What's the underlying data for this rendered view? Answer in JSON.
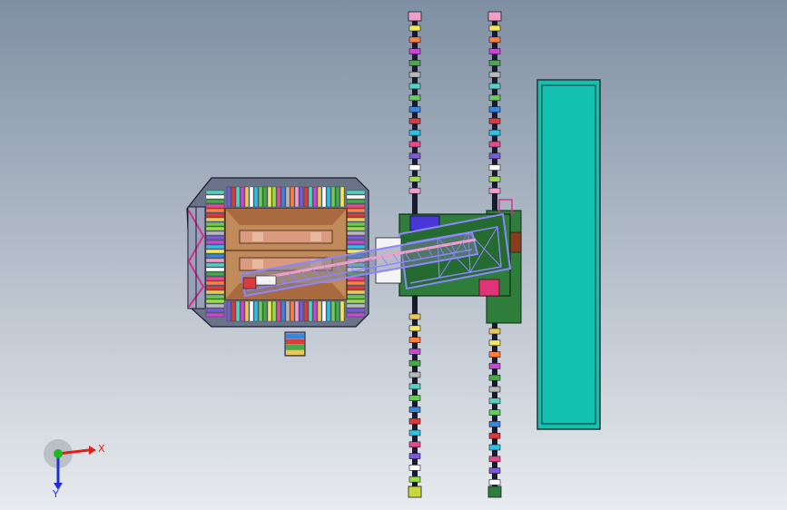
{
  "viewport": {
    "background_top": "#7f8fa3",
    "background_bottom": "#e8ebef"
  },
  "triad": {
    "x_label": "X",
    "y_label": "Y",
    "x_color": "#e0201c",
    "y_color": "#1fb81f",
    "z_color": "#1c2fe0"
  },
  "palette": {
    "plate_tan": "#c08a5a",
    "plate_salmon": "#d99a7e",
    "module_green": "#2e7d3a",
    "tank_teal": "#14c0b0",
    "boom_violet": "#8e86ff",
    "rail_dark": "#1a1a2e",
    "accent_pink": "#e0337a",
    "accent_blue": "#4a35d8",
    "accent_brown": "#8a3c1c"
  },
  "stripe_colors": [
    "#e84a8a",
    "#57d2c0",
    "#f2e95a",
    "#7b5cd6",
    "#6acb5a",
    "#ff7f3f",
    "#ffffff",
    "#3b86d8",
    "#c64ad2",
    "#9bde4a",
    "#dc3b3b",
    "#48a84a",
    "#f0a0c8",
    "#30c0e0",
    "#b8b8b8",
    "#e8c85a"
  ]
}
